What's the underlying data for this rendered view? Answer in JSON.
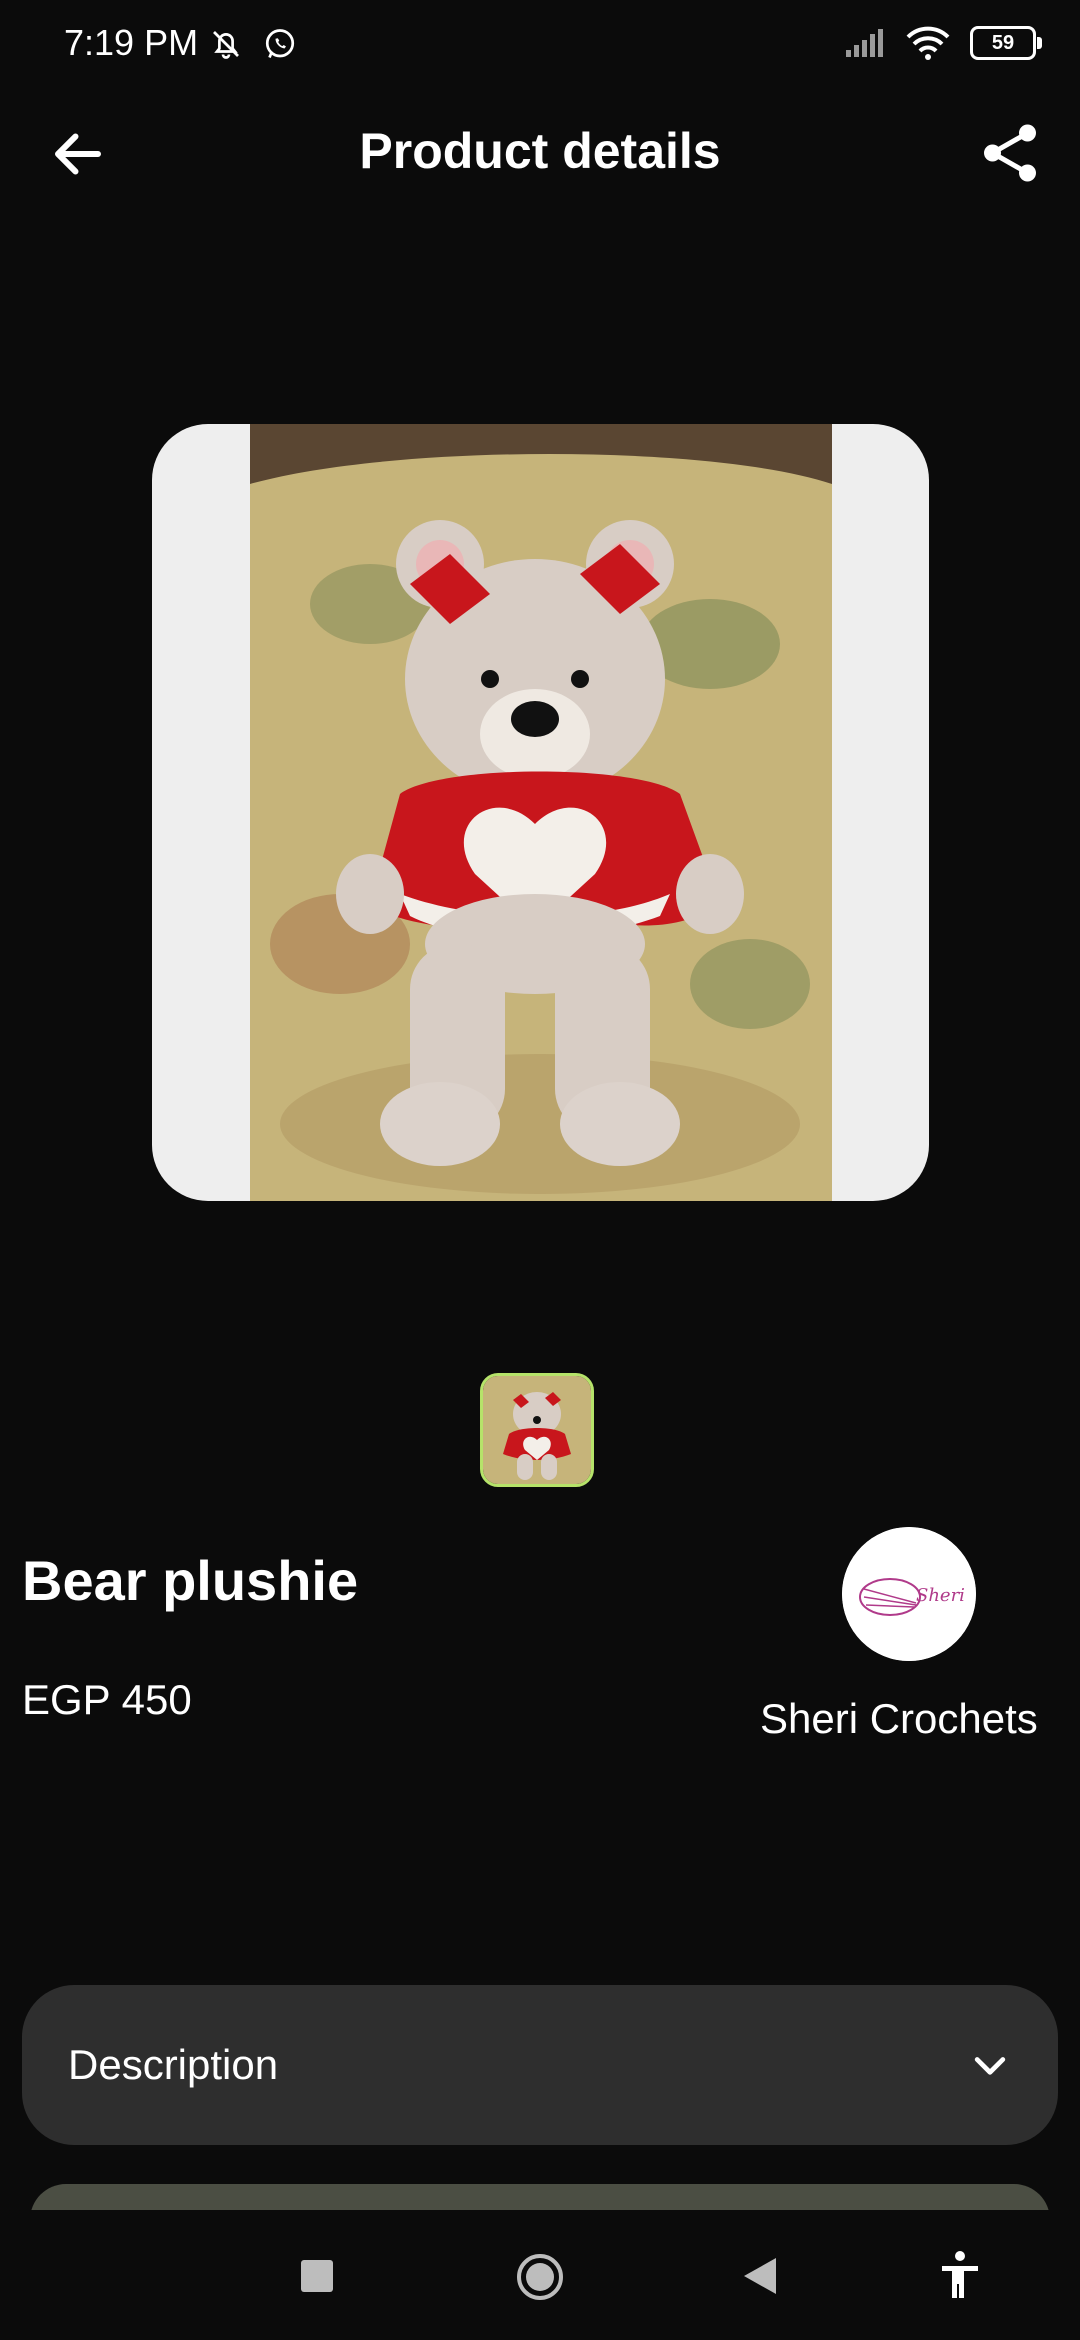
{
  "status_bar": {
    "time": "7:19 PM",
    "battery": "59",
    "icons": [
      "bell-muted-icon",
      "whatsapp-icon",
      "signal-icon",
      "wifi-icon",
      "battery-icon"
    ]
  },
  "header": {
    "title": "Product details",
    "back_icon": "arrow-left-icon",
    "share_icon": "share-icon"
  },
  "product": {
    "name": "Bear plushie",
    "price": "EGP 450",
    "image_description": "crocheted bear plushie with red bows and red sweater with white heart",
    "thumbnail_count": 1
  },
  "seller": {
    "name": "Sheri Crochets",
    "logo_text": "Sheri"
  },
  "description": {
    "label": "Description",
    "icon": "chevron-down-icon"
  },
  "colors": {
    "background": "#0b0b0b",
    "card": "#2e2e2e",
    "accent_border": "#b6e36a"
  }
}
